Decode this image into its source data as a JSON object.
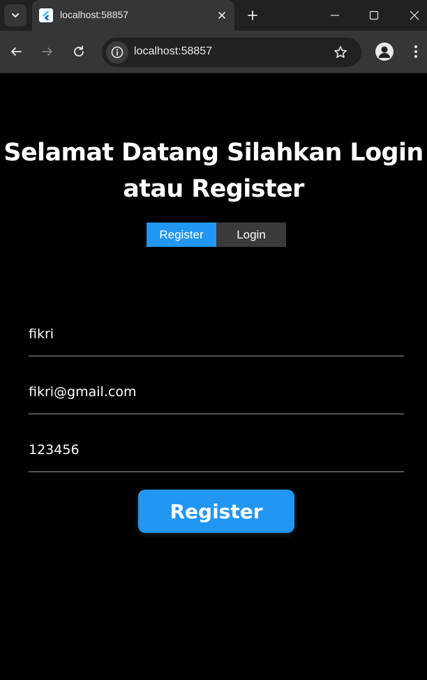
{
  "browser": {
    "tab_title": "localhost:58857",
    "url": "localhost:58857",
    "icons": {
      "tab_search": "chevron-down-icon",
      "favicon": "flutter-icon",
      "tab_close": "close-icon",
      "new_tab": "plus-icon",
      "back": "arrow-left-icon",
      "forward": "arrow-right-icon",
      "reload": "reload-icon",
      "site_info": "info-icon",
      "bookmark": "star-icon",
      "profile": "person-icon",
      "menu": "more-vertical-icon"
    },
    "colors": {
      "frame": "#202124",
      "toolbar": "#35363a"
    }
  },
  "page": {
    "heading_line1": "Selamat Datang Silahkan Login",
    "heading_line2": "atau Register",
    "toggle": {
      "register_label": "Register",
      "login_label": "Login",
      "active": "Register"
    },
    "form": {
      "name_value": "fikri",
      "email_value": "fikri@gmail.com",
      "password_value": "123456"
    },
    "submit_label": "Register",
    "colors": {
      "accent": "#2196f3",
      "background": "#000000",
      "inactive_toggle": "#3a3a3a"
    }
  }
}
